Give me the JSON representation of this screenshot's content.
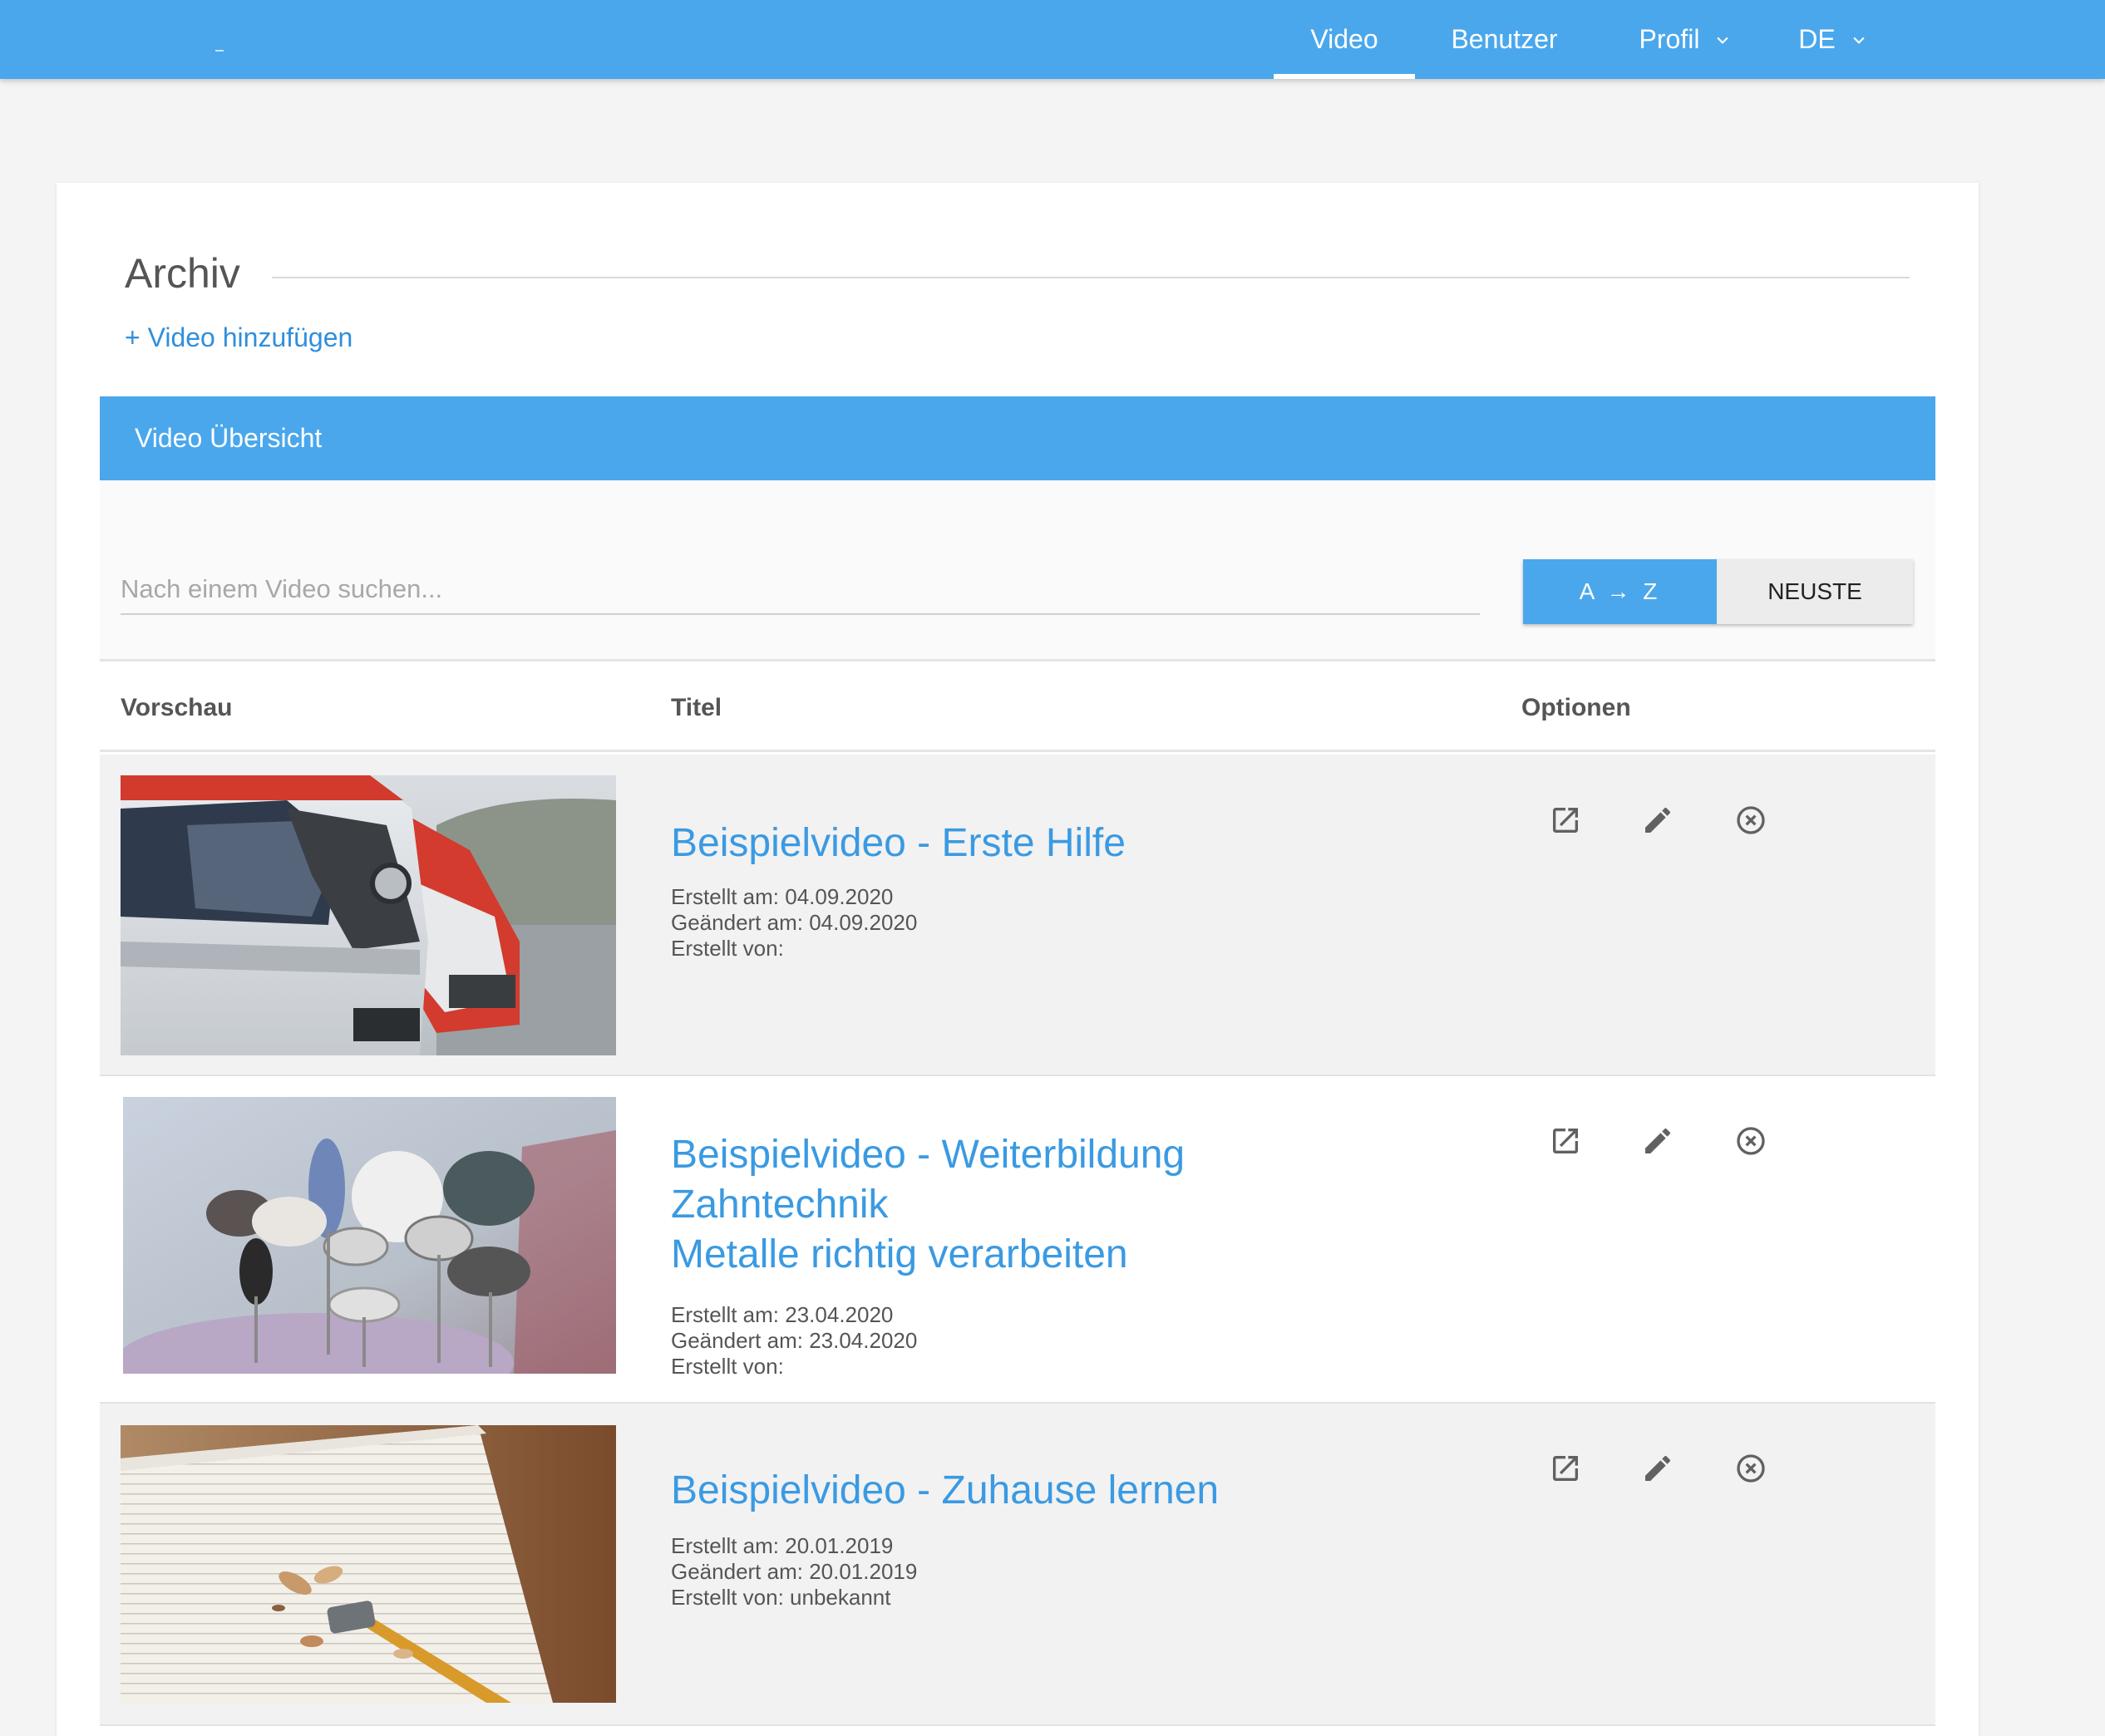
{
  "nav": {
    "items": [
      {
        "label": "Video",
        "active": true
      },
      {
        "label": "Benutzer"
      },
      {
        "label": "Profil",
        "dropdown": true
      },
      {
        "label": "DE",
        "dropdown": true
      }
    ]
  },
  "page": {
    "title": "Archiv",
    "add_video": "+ Video hinzufügen"
  },
  "panel": {
    "title": "Video Übersicht",
    "search_placeholder": "Nach einem Video suchen...",
    "sort_az": "A → Z",
    "sort_newest": "NEUSTE"
  },
  "table": {
    "headers": {
      "preview": "Vorschau",
      "title": "Titel",
      "options": "Optionen"
    },
    "rows": [
      {
        "title_lines": [
          "Beispielvideo - Erste Hilfe"
        ],
        "created": "Erstellt am: 04.09.2020",
        "changed": "Geändert am: 04.09.2020",
        "author": "Erstellt von:",
        "thumbnail": "ambulance-vans"
      },
      {
        "title_lines": [
          "Beispielvideo - Weiterbildung",
          "Zahntechnik",
          "Metalle richtig verarbeiten"
        ],
        "created": "Erstellt am: 23.04.2020",
        "changed": "Geändert am: 23.04.2020",
        "author": "Erstellt von:",
        "thumbnail": "dental-polishing-brushes"
      },
      {
        "title_lines": [
          "Beispielvideo - Zuhause lernen"
        ],
        "created": "Erstellt am: 20.01.2019",
        "changed": "Geändert am: 20.01.2019",
        "author": "Erstellt von: unbekannt",
        "thumbnail": "notebook-pencil"
      }
    ]
  },
  "icons": {
    "open": "external-link-icon",
    "edit": "pencil-icon",
    "delete": "close-circle-icon",
    "dropdown": "chevron-down-icon"
  },
  "colors": {
    "accent": "#4aa7ec",
    "link": "#3a9ae2",
    "row_shade": "#f2f2f2"
  }
}
